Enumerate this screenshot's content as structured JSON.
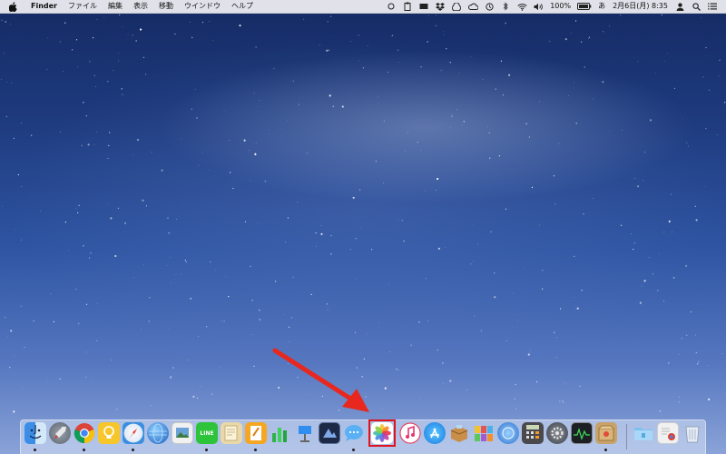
{
  "menubar": {
    "app_name": "Finder",
    "menus": [
      "ファイル",
      "編集",
      "表示",
      "移動",
      "ウインドウ",
      "ヘルプ"
    ],
    "battery": "100%",
    "input_method": "あ",
    "datetime": "2月6日(月)  8:35"
  },
  "dock": {
    "apps": [
      {
        "name": "Finder",
        "icon": "finder-icon"
      },
      {
        "name": "Launchpad",
        "icon": "launchpad-icon"
      },
      {
        "name": "Google Chrome",
        "icon": "chrome-icon"
      },
      {
        "name": "Tips",
        "icon": "tips-bulb-icon"
      },
      {
        "name": "Safari",
        "icon": "safari-compass-icon"
      },
      {
        "name": "Network app",
        "icon": "globe-app-icon"
      },
      {
        "name": "Preview",
        "icon": "preview-icon"
      },
      {
        "name": "LINE",
        "icon": "line-icon",
        "label": "LINE"
      },
      {
        "name": "Notes app",
        "icon": "notes-app-icon"
      },
      {
        "name": "Pages",
        "icon": "pages-icon"
      },
      {
        "name": "Numbers",
        "icon": "numbers-icon"
      },
      {
        "name": "Keynote",
        "icon": "keynote-icon"
      },
      {
        "name": "Photo editor",
        "icon": "photo-editor-icon"
      },
      {
        "name": "Messages",
        "icon": "messages-icon"
      },
      {
        "name": "Photos",
        "icon": "photos-icon"
      },
      {
        "name": "iTunes",
        "icon": "music-note-icon"
      },
      {
        "name": "App Store",
        "icon": "app-store-icon"
      },
      {
        "name": "Archive utility",
        "icon": "archive-box-icon"
      },
      {
        "name": "Colorful app",
        "icon": "colorful-grid-icon"
      },
      {
        "name": "Network utility",
        "icon": "network-utility-icon"
      },
      {
        "name": "Calculator",
        "icon": "calculator-icon"
      },
      {
        "name": "System Preferences",
        "icon": "gear-icon"
      },
      {
        "name": "Activity Monitor",
        "icon": "activity-monitor-icon"
      },
      {
        "name": "Package installer",
        "icon": "package-icon"
      },
      {
        "name": "Applications folder",
        "icon": "folder-icon"
      },
      {
        "name": "Downloads stack",
        "icon": "downloads-stack-icon"
      },
      {
        "name": "Trash",
        "icon": "trash-icon"
      }
    ],
    "highlighted_app": "Photos"
  },
  "colors": {
    "highlight_border": "#e0141e",
    "arrow": "#e8281e"
  }
}
